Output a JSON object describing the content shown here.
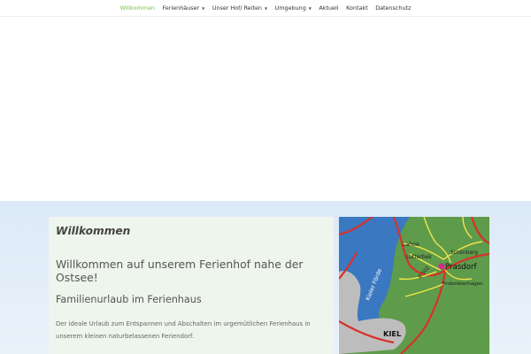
{
  "nav": {
    "items": [
      {
        "label": "Willkommen",
        "active": true,
        "has_dropdown": false
      },
      {
        "label": "Ferienhäuser",
        "active": false,
        "has_dropdown": true
      },
      {
        "label": "Unser Hof/ Reiten",
        "active": false,
        "has_dropdown": true
      },
      {
        "label": "Umgebung",
        "active": false,
        "has_dropdown": true
      },
      {
        "label": "Aktuell",
        "active": false,
        "has_dropdown": false
      },
      {
        "label": "Kontakt",
        "active": false,
        "has_dropdown": false
      },
      {
        "label": "Datenschutz",
        "active": false,
        "has_dropdown": false
      }
    ],
    "dropdown_icon": "caret-down-icon",
    "active_color": "#7ac142"
  },
  "content": {
    "title": "Willkommen",
    "heading": "Willkommen auf unserem Ferienhof nahe der Ostsee!",
    "subheading": "Familienurlaub im Ferienhaus",
    "paragraph": "Der ideale Urlaub zum Entspannen und Abschalten im urgemütlichen Ferienhaus in unserem kleinen naturbelassenen Feriendorf."
  },
  "map": {
    "labels": {
      "prasdorf": "Prasdorf",
      "lahoe": "Lahoe",
      "schoenberg": "Schönberg",
      "lutterbek": "Lutterbek",
      "probsteierhagen": "Probsteierhagen",
      "b502": "B 502",
      "kieler_foerde": "Kieler Förde",
      "kiel": "KIEL"
    },
    "colors": {
      "land": "#5e9b4a",
      "water": "#3a78c2",
      "city": "#bdbdbd",
      "road_major": "#d8312a",
      "road_minor": "#f2e64b",
      "marker": "#d62a8f"
    }
  }
}
